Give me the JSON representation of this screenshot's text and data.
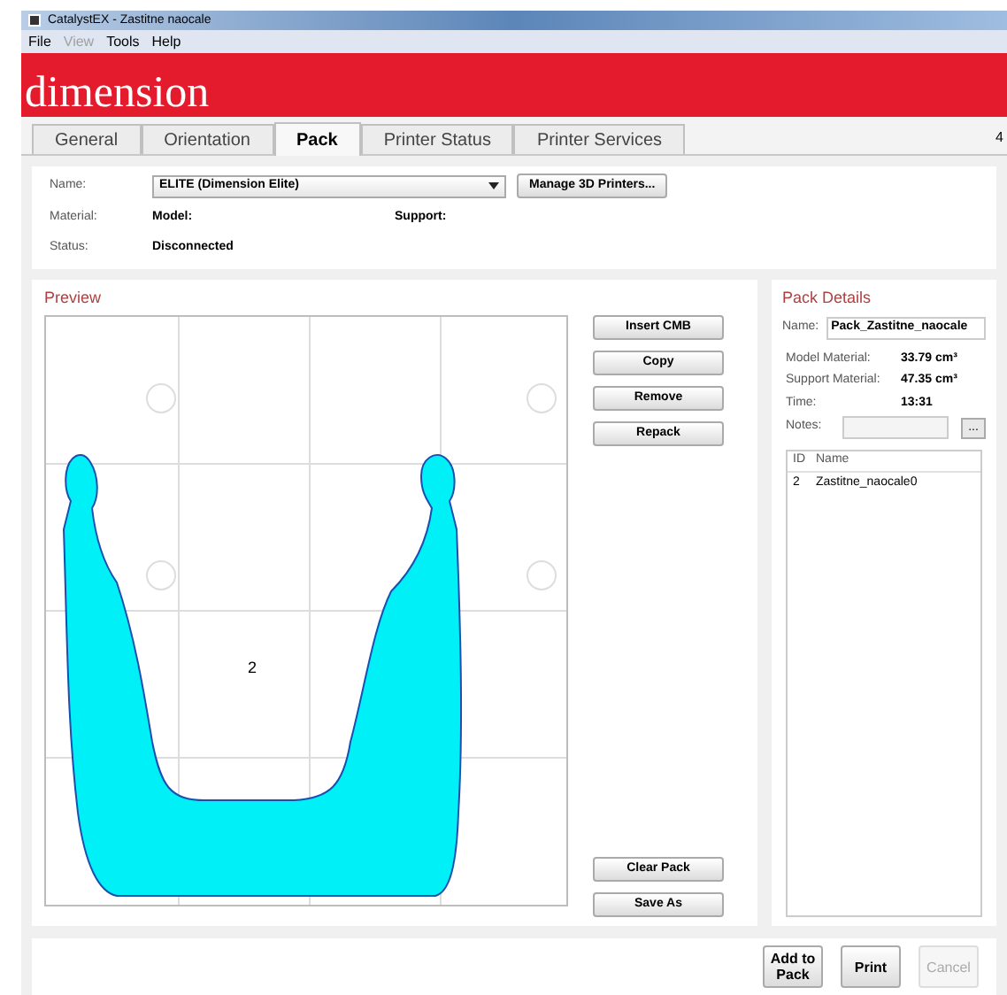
{
  "window": {
    "title": "CatalystEX - Zastitne naocale"
  },
  "menu": [
    {
      "label": "File",
      "disabled": false
    },
    {
      "label": "View",
      "disabled": true
    },
    {
      "label": "Tools",
      "disabled": false
    },
    {
      "label": "Help",
      "disabled": false
    }
  ],
  "brand": "dimension",
  "tabs": [
    {
      "label": "General",
      "selected": false
    },
    {
      "label": "Orientation",
      "selected": false
    },
    {
      "label": "Pack",
      "selected": true
    },
    {
      "label": "Printer Status",
      "selected": false
    },
    {
      "label": "Printer Services",
      "selected": false
    }
  ],
  "tab_strip_edge": "4",
  "printer": {
    "name_label": "Name:",
    "name_value": "ELITE  (Dimension Elite)",
    "manage_button": "Manage 3D Printers...",
    "material_label": "Material:",
    "model_label": "Model:",
    "support_label": "Support:",
    "status_label": "Status:",
    "status_value": "Disconnected"
  },
  "preview": {
    "title": "Preview",
    "part_label": "2"
  },
  "pack_actions": [
    "Insert CMB",
    "Copy",
    "Remove",
    "Repack"
  ],
  "pack_actions_bottom": [
    "Clear Pack",
    "Save As"
  ],
  "pack_details": {
    "title": "Pack Details",
    "name_label": "Name:",
    "name_value": "Pack_Zastitne_naocale",
    "stats": [
      {
        "label": "Model Material:",
        "value": "33.79 cm³"
      },
      {
        "label": "Support Material:",
        "value": "47.35 cm³"
      },
      {
        "label": "Time:",
        "value": "13:31"
      }
    ],
    "notes_label": "Notes:",
    "notes_button": "...",
    "columns": [
      "ID",
      "Name"
    ],
    "rows": [
      [
        "2",
        "Zastitne_naocale0"
      ]
    ]
  },
  "footer_buttons": [
    {
      "label": "Add to Pack",
      "disabled": false
    },
    {
      "label": "Print",
      "disabled": false
    },
    {
      "label": "Cancel",
      "disabled": true
    }
  ]
}
